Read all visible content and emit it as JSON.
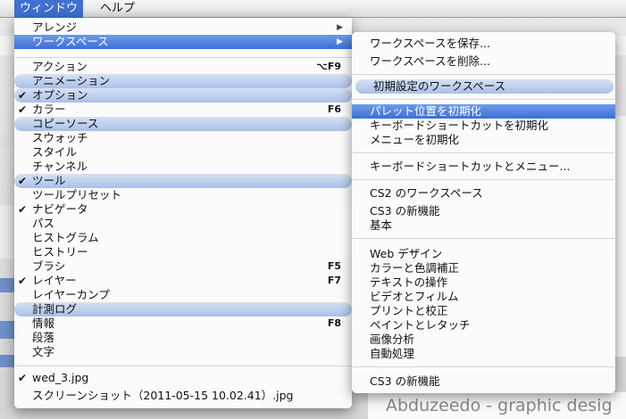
{
  "menubar": {
    "items": [
      {
        "label": "ウィンドウ",
        "active": true
      },
      {
        "label": "ヘルプ",
        "active": false
      }
    ]
  },
  "window_menu": {
    "items": [
      {
        "label": "アレンジ",
        "submenu": true
      },
      {
        "label": "ワークスペース",
        "submenu": true,
        "selected": true
      },
      {
        "label": "アクション",
        "shortcut": "⌥F9"
      },
      {
        "label": "アニメーション"
      },
      {
        "label": "オプション",
        "checked": true
      },
      {
        "label": "カラー",
        "checked": true,
        "shortcut": "F6"
      },
      {
        "label": "コピーソース"
      },
      {
        "label": "スウォッチ"
      },
      {
        "label": "スタイル"
      },
      {
        "label": "チャンネル"
      },
      {
        "label": "ツール",
        "checked": true
      },
      {
        "label": "ツールプリセット"
      },
      {
        "label": "ナビゲータ",
        "checked": true
      },
      {
        "label": "パス"
      },
      {
        "label": "ヒストグラム"
      },
      {
        "label": "ヒストリー"
      },
      {
        "label": "ブラシ",
        "shortcut": "F5"
      },
      {
        "label": "レイヤー",
        "checked": true,
        "shortcut": "F7"
      },
      {
        "label": "レイヤーカンプ"
      },
      {
        "label": "計測ログ"
      },
      {
        "label": "情報",
        "shortcut": "F8"
      },
      {
        "label": "段落"
      },
      {
        "label": "文字"
      },
      {
        "label": "wed_3.jpg",
        "checked": true
      },
      {
        "label": "スクリーンショット（2011-05-15 10.02.41）.jpg"
      }
    ]
  },
  "workspace_submenu": {
    "items": [
      {
        "label": "ワークスペースを保存..."
      },
      {
        "label": "ワークスペースを削除..."
      },
      {
        "label": "初期設定のワークスペース"
      },
      {
        "label": "パレット位置を初期化",
        "selected": true
      },
      {
        "label": "キーボードショートカットを初期化"
      },
      {
        "label": "メニューを初期化"
      },
      {
        "label": "キーボードショートカットとメニュー..."
      },
      {
        "label": "CS2 のワークスペース"
      },
      {
        "label": "CS3 の新機能"
      },
      {
        "label": "基本"
      },
      {
        "label": "Web デザイン"
      },
      {
        "label": "カラーと色調補正"
      },
      {
        "label": "テキストの操作"
      },
      {
        "label": "ビデオとフィルム"
      },
      {
        "label": "プリントと校正"
      },
      {
        "label": "ペイントとレタッチ"
      },
      {
        "label": "画像分析"
      },
      {
        "label": "自動処理"
      },
      {
        "label": "CS3 の新機能"
      }
    ]
  },
  "background": {
    "bottom_text": "Abduzeedo - graphic desig"
  },
  "icons": {
    "checkmark": "checkmark-icon",
    "submenu_arrow": "submenu-arrow-icon"
  }
}
